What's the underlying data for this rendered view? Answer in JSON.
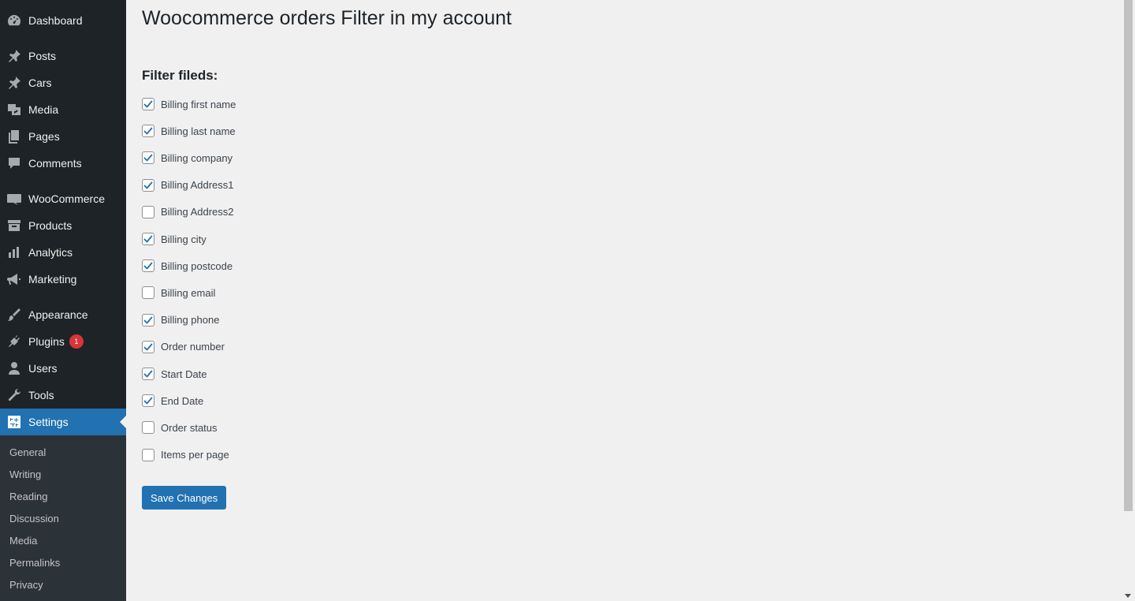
{
  "sidebar": {
    "items": [
      {
        "label": "Dashboard",
        "icon": "dashboard-icon"
      },
      {
        "label": "Posts",
        "icon": "pin-icon"
      },
      {
        "label": "Cars",
        "icon": "pin-icon"
      },
      {
        "label": "Media",
        "icon": "media-icon"
      },
      {
        "label": "Pages",
        "icon": "pages-icon"
      },
      {
        "label": "Comments",
        "icon": "comment-icon"
      },
      {
        "label": "WooCommerce",
        "icon": "woo-icon"
      },
      {
        "label": "Products",
        "icon": "archive-icon"
      },
      {
        "label": "Analytics",
        "icon": "bar-chart-icon"
      },
      {
        "label": "Marketing",
        "icon": "megaphone-icon"
      },
      {
        "label": "Appearance",
        "icon": "brush-icon"
      },
      {
        "label": "Plugins",
        "icon": "plugin-icon",
        "badge": "1"
      },
      {
        "label": "Users",
        "icon": "user-icon"
      },
      {
        "label": "Tools",
        "icon": "wrench-icon"
      },
      {
        "label": "Settings",
        "icon": "settings-icon",
        "current": true
      }
    ],
    "submenu": [
      "General",
      "Writing",
      "Reading",
      "Discussion",
      "Media",
      "Permalinks",
      "Privacy"
    ]
  },
  "main": {
    "title": "Woocommerce orders Filter in my account",
    "section_title": "Filter fileds:",
    "fields": [
      {
        "label": "Billing first name",
        "checked": true
      },
      {
        "label": "Billing last name",
        "checked": true
      },
      {
        "label": "Billing company",
        "checked": true
      },
      {
        "label": "Billing Address1",
        "checked": true
      },
      {
        "label": "Billing Address2",
        "checked": false
      },
      {
        "label": "Billing city",
        "checked": true
      },
      {
        "label": "Billing postcode",
        "checked": true
      },
      {
        "label": "Billing email",
        "checked": false
      },
      {
        "label": "Billing phone",
        "checked": true
      },
      {
        "label": "Order number",
        "checked": true
      },
      {
        "label": "Start Date",
        "checked": true
      },
      {
        "label": "End Date",
        "checked": true
      },
      {
        "label": "Order status",
        "checked": false
      },
      {
        "label": "Items per page",
        "checked": false
      }
    ],
    "save_label": "Save Changes"
  },
  "colors": {
    "sidebar_bg": "#1d2327",
    "submenu_bg": "#2c3338",
    "accent": "#2271b1",
    "badge": "#d63638",
    "page_bg": "#f0f0f1"
  }
}
